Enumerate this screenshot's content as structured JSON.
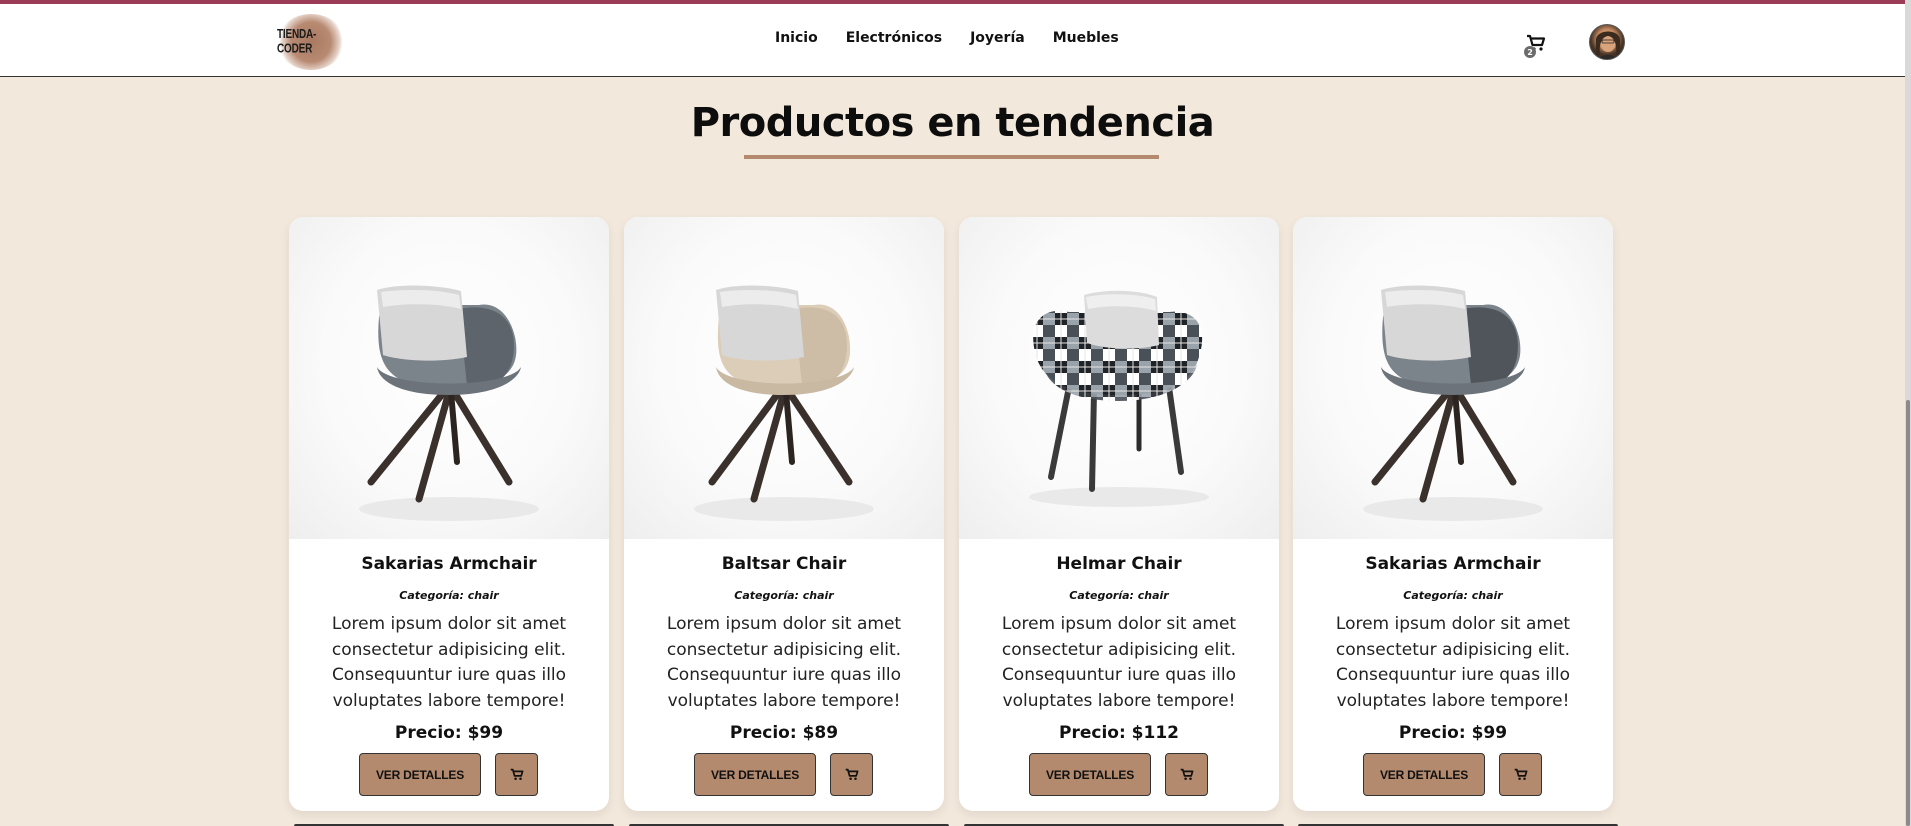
{
  "navbar": {
    "logo_text": "TIENDA-CODER",
    "links": [
      "Inicio",
      "Electrónicos",
      "Joyería",
      "Muebles"
    ],
    "cart_count": "2"
  },
  "section": {
    "title": "Productos en tendencia"
  },
  "products": [
    {
      "name": "Sakarias Armchair",
      "category": "Categoría: chair",
      "description": "Lorem ipsum dolor sit amet consectetur adipisicing elit. Consequuntur iure quas illo voluptates labore tempore!",
      "price": "Precio: $99",
      "details_label": "VER DETALLES",
      "chair_style": "grey"
    },
    {
      "name": "Baltsar Chair",
      "category": "Categoría: chair",
      "description": "Lorem ipsum dolor sit amet consectetur adipisicing elit. Consequuntur iure quas illo voluptates labore tempore!",
      "price": "Precio: $89",
      "details_label": "VER DETALLES",
      "chair_style": "beige"
    },
    {
      "name": "Helmar Chair",
      "category": "Categoría: chair",
      "description": "Lorem ipsum dolor sit amet consectetur adipisicing elit. Consequuntur iure quas illo voluptates labore tempore!",
      "price": "Precio: $112",
      "details_label": "VER DETALLES",
      "chair_style": "plaid"
    },
    {
      "name": "Sakarias Armchair",
      "category": "Categoría: chair",
      "description": "Lorem ipsum dolor sit amet consectetur adipisicing elit. Consequuntur iure quas illo voluptates labore tempore!",
      "price": "Precio: $99",
      "details_label": "VER DETALLES",
      "chair_style": "grey"
    }
  ],
  "colors": {
    "page_bg": "#f3e8dc",
    "accent": "#b38a6e",
    "top_border": "#9b3b55"
  }
}
